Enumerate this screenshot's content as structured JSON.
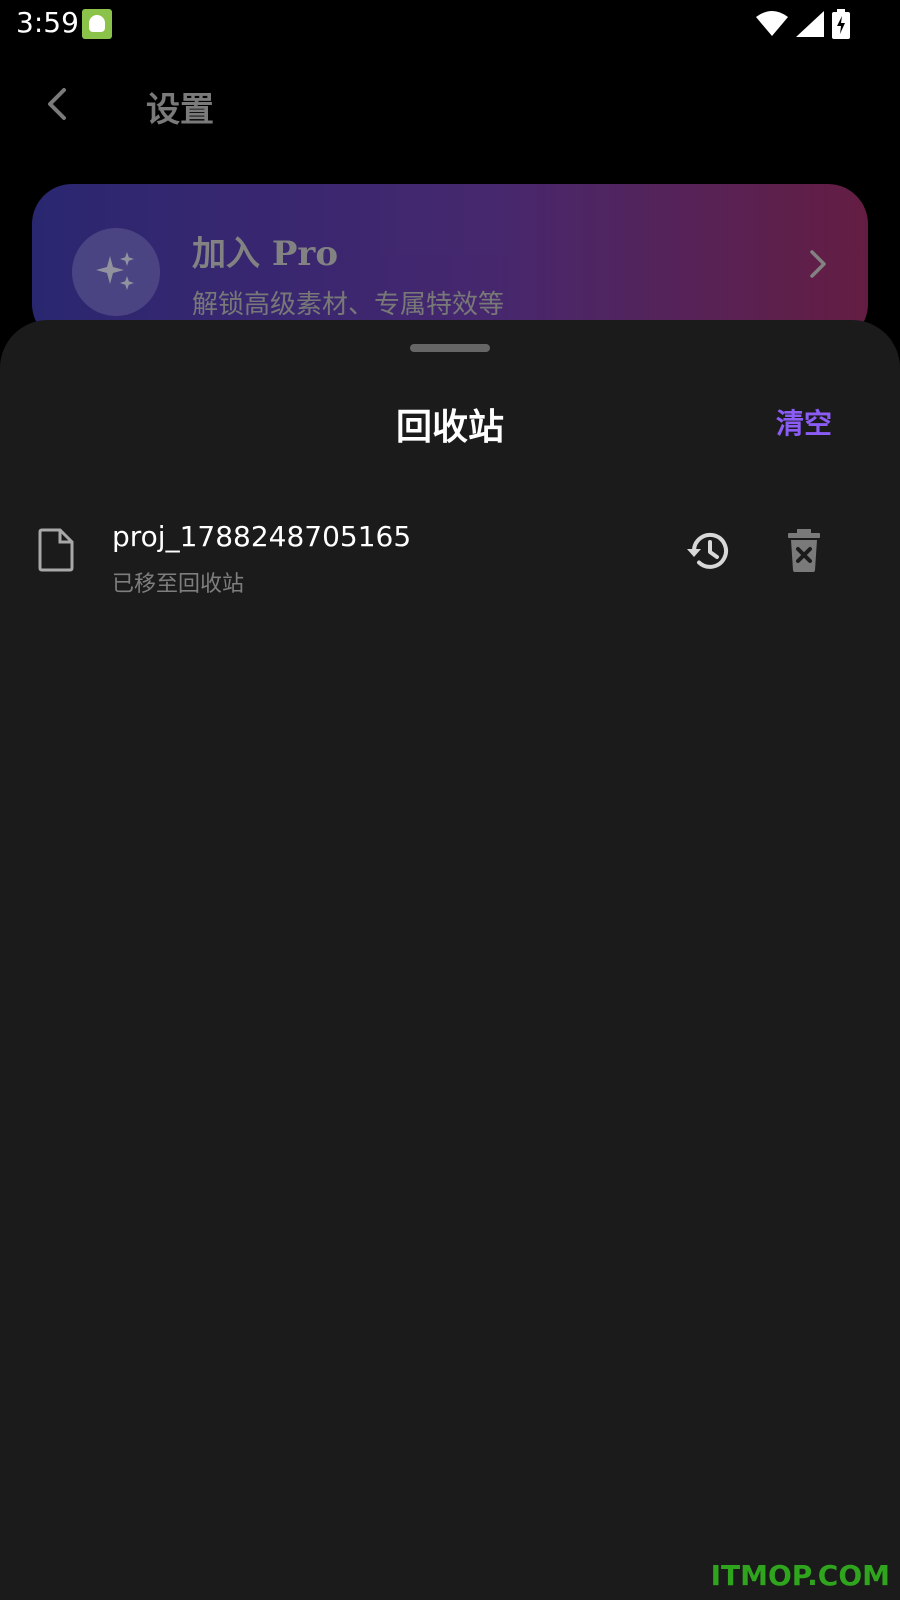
{
  "status_bar": {
    "time": "3:59",
    "icons": [
      "app-notification-icon",
      "wifi-icon",
      "signal-icon",
      "battery-charging-icon"
    ]
  },
  "app_bar": {
    "title": "设置",
    "back_icon": "chevron-left-icon"
  },
  "pro_banner": {
    "title": "加入 Pro",
    "subtitle": "解锁高级素材、专属特效等",
    "icon": "sparkles-icon",
    "chevron_icon": "chevron-right-icon"
  },
  "sheet": {
    "title": "回收站",
    "clear_label": "清空",
    "items": [
      {
        "name": "proj_1788248705165",
        "status": "已移至回收站",
        "icon": "file-icon",
        "actions": [
          "restore-icon",
          "delete-forever-icon"
        ]
      }
    ]
  },
  "watermark": "ITMOP.COM",
  "colors": {
    "accent": "#8b5cf6",
    "sheet_bg": "#1b1b1b",
    "watermark": "#2fa51d"
  }
}
